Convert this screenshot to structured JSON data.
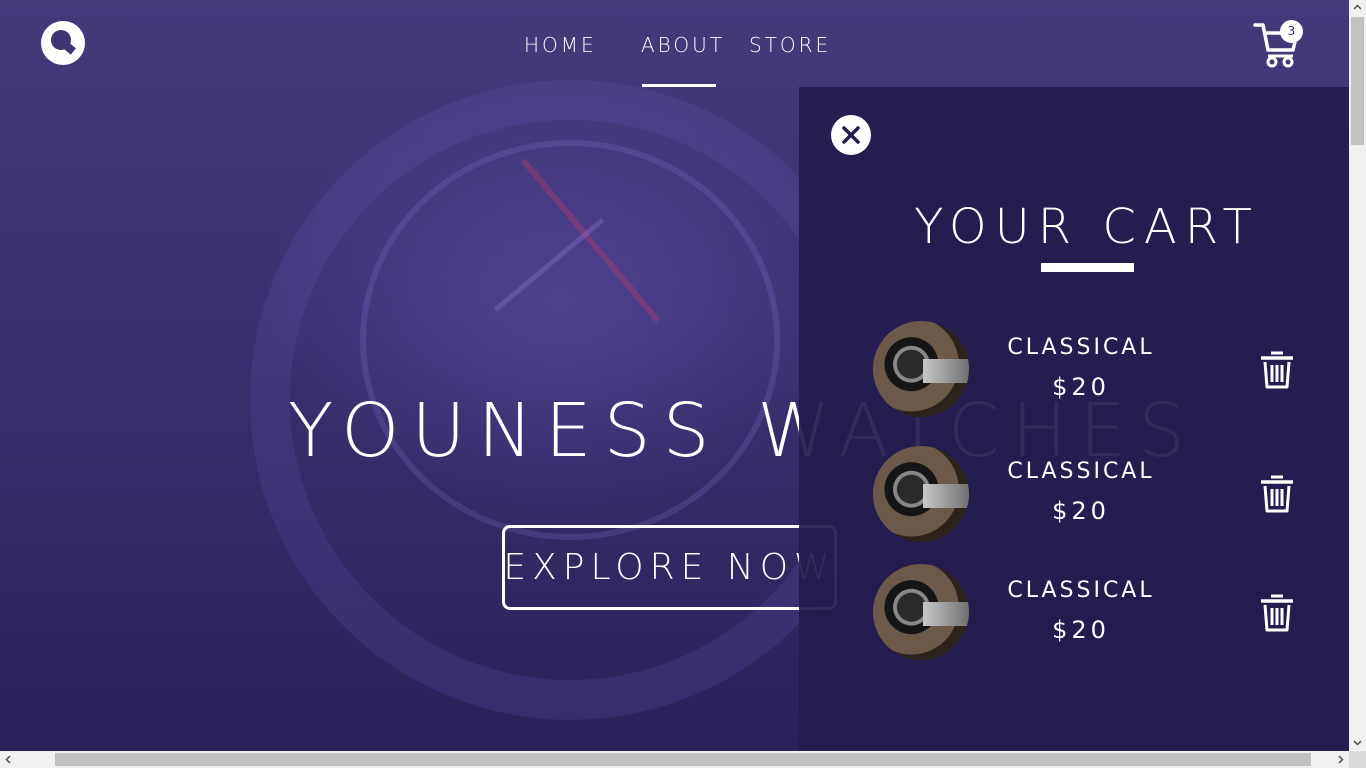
{
  "nav": {
    "items": [
      {
        "label": "HOME"
      },
      {
        "label": "ABOUT"
      },
      {
        "label": "STORE"
      }
    ],
    "active": "ABOUT"
  },
  "cart_badge": {
    "count": "3"
  },
  "hero": {
    "title": "YOUNESS WATCHES",
    "button_label": "EXPLORE NOW"
  },
  "cart": {
    "title": "YOUR CART",
    "items": [
      {
        "name": "CLASSICAL",
        "price": "$20"
      },
      {
        "name": "CLASSICAL",
        "price": "$20"
      },
      {
        "name": "CLASSICAL",
        "price": "$20"
      }
    ]
  },
  "icons": {
    "logo": "logo-icon",
    "cart": "cart-icon",
    "close": "close-icon",
    "delete": "trash-icon"
  },
  "colors": {
    "background": "#3b306f",
    "panel": "#241c4e",
    "text": "#ffffff"
  }
}
